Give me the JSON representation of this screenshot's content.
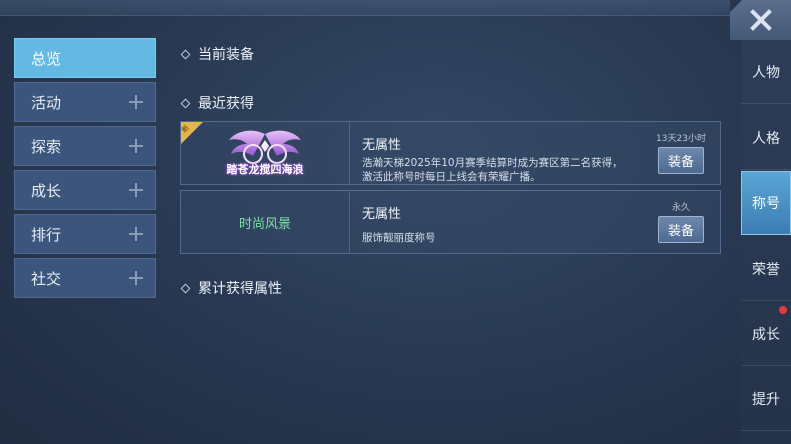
{
  "sidebar": {
    "items": [
      {
        "label": "总览",
        "active": true
      },
      {
        "label": "活动",
        "active": false
      },
      {
        "label": "探索",
        "active": false
      },
      {
        "label": "成长",
        "active": false
      },
      {
        "label": "排行",
        "active": false
      },
      {
        "label": "社交",
        "active": false
      }
    ]
  },
  "sections": {
    "current_equip": "当前装备",
    "recent": "最近获得",
    "cumulative": "累计获得属性"
  },
  "titles": [
    {
      "badge_text": "新",
      "image_text": "踏苍龙搅四海浪",
      "name": "无属性",
      "desc_line1": "浩瀚天梯2025年10月赛季结算时成为赛区第二名获得，",
      "desc_line2": "激活此称号时每日上线会有荣耀广播。",
      "time": "13天23小时",
      "button": "装备"
    },
    {
      "image_text": "时尚风景",
      "name": "无属性",
      "desc_line1": "服饰靓丽度称号",
      "time": "永久",
      "button": "装备"
    }
  ],
  "right_tabs": [
    {
      "label": "人物",
      "active": false
    },
    {
      "label": "人格",
      "active": false
    },
    {
      "label": "称号",
      "active": true
    },
    {
      "label": "荣誉",
      "active": false
    },
    {
      "label": "成长",
      "active": false,
      "red_dot": true
    },
    {
      "label": "提升",
      "active": false
    }
  ],
  "colors": {
    "accent": "#63b8e4",
    "fashion_green": "#7ee2a8",
    "badge_gold": "#e2b64b",
    "alert_red": "#e23b3b"
  }
}
